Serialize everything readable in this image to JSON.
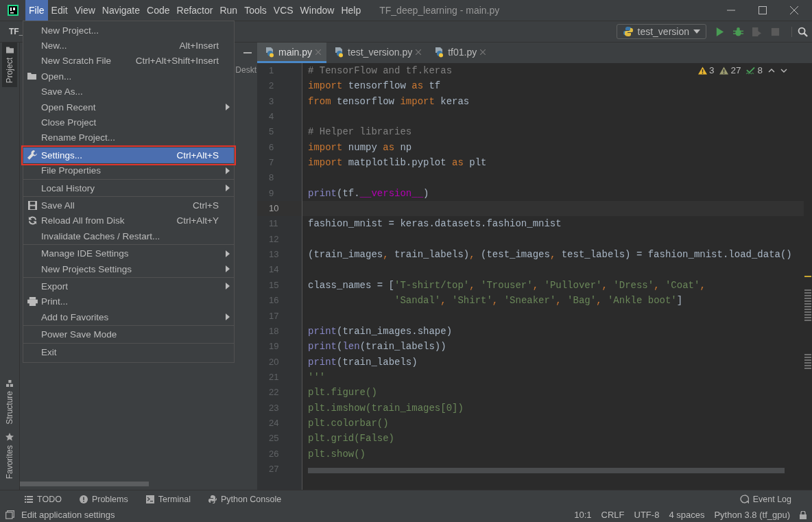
{
  "window": {
    "title": "TF_deep_learning - main.py"
  },
  "menu_bar": [
    {
      "label": "File",
      "selected": true
    },
    {
      "label": "Edit",
      "selected": false
    },
    {
      "label": "View",
      "selected": false
    },
    {
      "label": "Navigate",
      "selected": false
    },
    {
      "label": "Code",
      "selected": false
    },
    {
      "label": "Refactor",
      "selected": false
    },
    {
      "label": "Run",
      "selected": false
    },
    {
      "label": "Tools",
      "selected": false
    },
    {
      "label": "VCS",
      "selected": false
    },
    {
      "label": "Window",
      "selected": false
    },
    {
      "label": "Help",
      "selected": false
    }
  ],
  "navigation": {
    "project": "TF_"
  },
  "run_config": {
    "label": "test_version"
  },
  "toolbar_buttons": [
    {
      "kind": "run",
      "disabled": false
    },
    {
      "kind": "debug",
      "disabled": false
    },
    {
      "kind": "coverage",
      "disabled": true
    },
    {
      "kind": "stop",
      "disabled": true
    }
  ],
  "side_tabs": [
    {
      "label": "Project",
      "selected": true,
      "kind": "folder"
    },
    {
      "label": "Structure",
      "selected": false,
      "kind": "structure"
    },
    {
      "label": "Favorites",
      "selected": false,
      "kind": "star"
    }
  ],
  "project_panel": {
    "visible_text": "Deskt"
  },
  "editor_tabs": [
    {
      "label": "main.py",
      "selected": true
    },
    {
      "label": "test_version.py",
      "selected": false
    },
    {
      "label": "tf01.py",
      "selected": false
    }
  ],
  "inspections": [
    {
      "kind": "warning",
      "count": "3"
    },
    {
      "kind": "weak-warning",
      "count": "27"
    },
    {
      "kind": "typo",
      "count": "8"
    }
  ],
  "code": [
    {
      "n": "1",
      "current": false,
      "tokens": [
        {
          "t": "# TensorFlow and tf.keras",
          "kind": "comment"
        }
      ]
    },
    {
      "n": "2",
      "current": false,
      "tokens": [
        {
          "t": "import",
          "kind": "kw"
        },
        {
          "t": " tensorflow ",
          "kind": "plain"
        },
        {
          "t": "as",
          "kind": "kw"
        },
        {
          "t": " tf",
          "kind": "plain"
        }
      ]
    },
    {
      "n": "3",
      "current": false,
      "tokens": [
        {
          "t": "from",
          "kind": "kw"
        },
        {
          "t": " tensorflow ",
          "kind": "plain"
        },
        {
          "t": "import",
          "kind": "kw"
        },
        {
          "t": " keras",
          "kind": "plain"
        }
      ]
    },
    {
      "n": "4",
      "current": false
    },
    {
      "n": "5",
      "current": false,
      "tokens": [
        {
          "t": "# Helper libraries",
          "kind": "comment"
        }
      ]
    },
    {
      "n": "6",
      "current": false,
      "tokens": [
        {
          "t": "import",
          "kind": "kw"
        },
        {
          "t": " numpy ",
          "kind": "plain"
        },
        {
          "t": "as",
          "kind": "kw"
        },
        {
          "t": " np",
          "kind": "plain"
        }
      ]
    },
    {
      "n": "7",
      "current": false,
      "tokens": [
        {
          "t": "import",
          "kind": "kw"
        },
        {
          "t": " matplotlib.pyplot ",
          "kind": "plain"
        },
        {
          "t": "as",
          "kind": "kw"
        },
        {
          "t": " plt",
          "kind": "plain"
        }
      ]
    },
    {
      "n": "8",
      "current": false
    },
    {
      "n": "9",
      "current": false,
      "tokens": [
        {
          "t": "print",
          "kind": "builtin"
        },
        {
          "t": "(tf.",
          "kind": "plain"
        },
        {
          "t": "__version__",
          "kind": "magic"
        },
        {
          "t": ")",
          "kind": "plain"
        }
      ]
    },
    {
      "n": "10",
      "current": true
    },
    {
      "n": "11",
      "current": false,
      "tokens": [
        {
          "t": "fashion_mnist = keras.datasets.fashion_mnist",
          "kind": "plain"
        }
      ]
    },
    {
      "n": "12",
      "current": false
    },
    {
      "n": "13",
      "current": false,
      "tokens": [
        {
          "t": "(train_images",
          "kind": "plain"
        },
        {
          "t": ",",
          "kind": "kw"
        },
        {
          "t": " train_labels)",
          "kind": "plain"
        },
        {
          "t": ",",
          "kind": "kw"
        },
        {
          "t": " (test_images",
          "kind": "plain"
        },
        {
          "t": ",",
          "kind": "kw"
        },
        {
          "t": " test_labels) = fashion_mnist.load_data()",
          "kind": "plain"
        }
      ]
    },
    {
      "n": "14",
      "current": false
    },
    {
      "n": "15",
      "current": false,
      "tokens": [
        {
          "t": "class_names = [",
          "kind": "plain"
        },
        {
          "t": "'T-shirt/top'",
          "kind": "str"
        },
        {
          "t": ", ",
          "kind": "kw"
        },
        {
          "t": "'Trouser'",
          "kind": "str"
        },
        {
          "t": ", ",
          "kind": "kw"
        },
        {
          "t": "'Pullover'",
          "kind": "str"
        },
        {
          "t": ", ",
          "kind": "kw"
        },
        {
          "t": "'Dress'",
          "kind": "str"
        },
        {
          "t": ", ",
          "kind": "kw"
        },
        {
          "t": "'Coat'",
          "kind": "str"
        },
        {
          "t": ",",
          "kind": "kw"
        }
      ]
    },
    {
      "n": "16",
      "current": false,
      "tokens": [
        {
          "t": "               'Sandal'",
          "kind": "str"
        },
        {
          "t": ", ",
          "kind": "kw"
        },
        {
          "t": "'Shirt'",
          "kind": "str"
        },
        {
          "t": ", ",
          "kind": "kw"
        },
        {
          "t": "'Sneaker'",
          "kind": "str"
        },
        {
          "t": ", ",
          "kind": "kw"
        },
        {
          "t": "'Bag'",
          "kind": "str"
        },
        {
          "t": ", ",
          "kind": "kw"
        },
        {
          "t": "'Ankle boot'",
          "kind": "str"
        },
        {
          "t": "]",
          "kind": "plain"
        }
      ]
    },
    {
      "n": "17",
      "current": false
    },
    {
      "n": "18",
      "current": false,
      "tokens": [
        {
          "t": "print",
          "kind": "builtin"
        },
        {
          "t": "(train_images.shape)",
          "kind": "plain"
        }
      ]
    },
    {
      "n": "19",
      "current": false,
      "tokens": [
        {
          "t": "print",
          "kind": "builtin"
        },
        {
          "t": "(",
          "kind": "plain"
        },
        {
          "t": "len",
          "kind": "builtin"
        },
        {
          "t": "(train_labels))",
          "kind": "plain"
        }
      ]
    },
    {
      "n": "20",
      "current": false,
      "tokens": [
        {
          "t": "print",
          "kind": "builtin"
        },
        {
          "t": "(train_labels)",
          "kind": "plain"
        }
      ]
    },
    {
      "n": "21",
      "current": false,
      "tokens": [
        {
          "t": "'''",
          "kind": "str"
        }
      ]
    },
    {
      "n": "22",
      "current": false,
      "tokens": [
        {
          "t": "plt.figure()",
          "kind": "str"
        }
      ]
    },
    {
      "n": "23",
      "current": false,
      "tokens": [
        {
          "t": "plt.imshow(train_images[0])",
          "kind": "str"
        }
      ]
    },
    {
      "n": "24",
      "current": false,
      "tokens": [
        {
          "t": "plt.colorbar()",
          "kind": "str"
        }
      ]
    },
    {
      "n": "25",
      "current": false,
      "tokens": [
        {
          "t": "plt.grid(False)",
          "kind": "str"
        }
      ]
    },
    {
      "n": "26",
      "current": false,
      "tokens": [
        {
          "t": "plt.show()",
          "kind": "str"
        }
      ]
    },
    {
      "n": "27",
      "current": false
    }
  ],
  "file_menu": [
    [
      {
        "label": "New Project...",
        "submenu": false,
        "selected": false,
        "outlined": false
      },
      {
        "label": "New...",
        "shortcut": "Alt+Insert",
        "submenu": false,
        "selected": false,
        "outlined": false
      },
      {
        "label": "New Scratch File",
        "shortcut": "Ctrl+Alt+Shift+Insert",
        "submenu": false,
        "selected": false,
        "outlined": false
      },
      {
        "label": "Open...",
        "submenu": false,
        "selected": false,
        "outlined": false
      },
      {
        "label": "Save As...",
        "submenu": false,
        "selected": false,
        "outlined": false
      },
      {
        "label": "Open Recent",
        "submenu": true,
        "selected": false,
        "outlined": false
      },
      {
        "label": "Close Project",
        "submenu": false,
        "selected": false,
        "outlined": false
      },
      {
        "label": "Rename Project...",
        "submenu": false,
        "selected": false,
        "outlined": false
      }
    ],
    [
      {
        "label": "Settings...",
        "shortcut": "Ctrl+Alt+S",
        "submenu": false,
        "selected": true,
        "outlined": true
      },
      {
        "label": "File Properties",
        "submenu": true,
        "selected": false,
        "outlined": false
      }
    ],
    [
      {
        "label": "Local History",
        "submenu": true,
        "selected": false,
        "outlined": false
      }
    ],
    [
      {
        "label": "Save All",
        "shortcut": "Ctrl+S",
        "submenu": false,
        "selected": false,
        "outlined": false
      },
      {
        "label": "Reload All from Disk",
        "shortcut": "Ctrl+Alt+Y",
        "submenu": false,
        "selected": false,
        "outlined": false
      },
      {
        "label": "Invalidate Caches / Restart...",
        "submenu": false,
        "selected": false,
        "outlined": false
      }
    ],
    [
      {
        "label": "Manage IDE Settings",
        "submenu": true,
        "selected": false,
        "outlined": false
      },
      {
        "label": "New Projects Settings",
        "submenu": true,
        "selected": false,
        "outlined": false
      }
    ],
    [
      {
        "label": "Export",
        "submenu": true,
        "selected": false,
        "outlined": false
      },
      {
        "label": "Print...",
        "submenu": false,
        "selected": false,
        "outlined": false
      },
      {
        "label": "Add to Favorites",
        "submenu": true,
        "selected": false,
        "outlined": false
      }
    ],
    [
      {
        "label": "Power Save Mode",
        "submenu": false,
        "selected": false,
        "outlined": false
      }
    ],
    [
      {
        "label": "Exit",
        "submenu": false,
        "selected": false,
        "outlined": false
      }
    ]
  ],
  "bottom_tabs": [
    {
      "label": "TODO",
      "kind": "todo"
    },
    {
      "label": "Problems",
      "kind": "problems"
    },
    {
      "label": "Terminal",
      "kind": "terminal"
    },
    {
      "label": "Python Console",
      "kind": "python"
    }
  ],
  "event_log": "Event Log",
  "status_bar": {
    "message": "Edit application settings",
    "items": [
      "10:1",
      "CRLF",
      "UTF-8",
      "4 spaces",
      "Python 3.8 (tf_gpu)"
    ]
  }
}
